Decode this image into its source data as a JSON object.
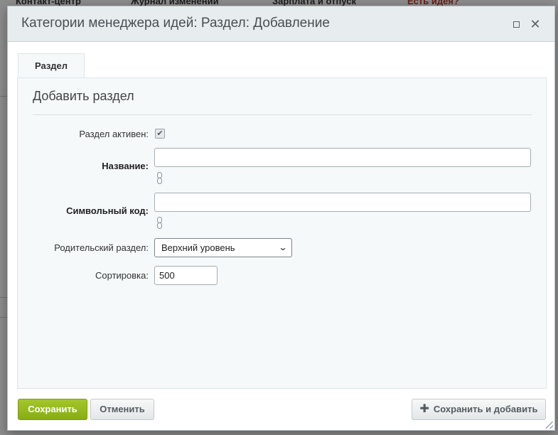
{
  "background": {
    "nav": [
      "Контакт-центр",
      "Журнал изменений",
      "Зарплата и отпуск",
      "Есть идея?"
    ]
  },
  "dialog": {
    "title": "Категории менеджера идей: Раздел: Добавление",
    "tab_label": "Раздел",
    "section_title": "Добавить раздел",
    "fields": {
      "active_label": "Раздел активен:",
      "active_checked": true,
      "name_label": "Название:",
      "name_value": "",
      "code_label": "Символьный код:",
      "code_value": "",
      "parent_label": "Родительский раздел:",
      "parent_selected": "Верхний уровень",
      "sort_label": "Сортировка:",
      "sort_value": "500"
    },
    "buttons": {
      "save": "Сохранить",
      "cancel": "Отменить",
      "save_add": "Сохранить и добавить"
    }
  },
  "colors": {
    "save_button": "#8db516",
    "titlebar": "#e7ecef",
    "panel": "#f5f9fa"
  },
  "icons": [
    "maximize-icon",
    "close-icon",
    "link-icon",
    "chevron-down-icon",
    "plus-icon",
    "checkmark-icon"
  ]
}
